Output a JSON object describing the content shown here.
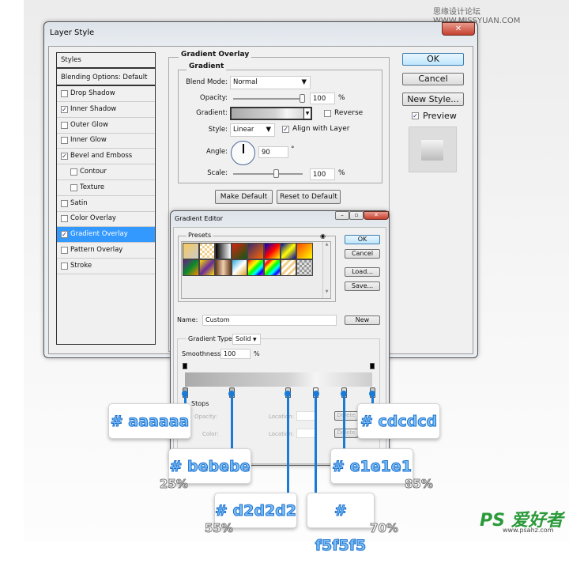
{
  "watermark": "思缘设计论坛  WWW.MISSYUAN.COM",
  "logo": {
    "text": "PS 爱好者",
    "url": "www.psahz.com"
  },
  "layer_style": {
    "title": "Layer Style",
    "styles_header": "Styles",
    "blending": "Blending Options: Default",
    "items": [
      {
        "label": "Drop Shadow",
        "checked": false
      },
      {
        "label": "Inner Shadow",
        "checked": true
      },
      {
        "label": "Outer Glow",
        "checked": false
      },
      {
        "label": "Inner Glow",
        "checked": false
      },
      {
        "label": "Bevel and Emboss",
        "checked": true
      },
      {
        "label": "Contour",
        "checked": false
      },
      {
        "label": "Texture",
        "checked": false
      },
      {
        "label": "Satin",
        "checked": false
      },
      {
        "label": "Color Overlay",
        "checked": false
      },
      {
        "label": "Gradient Overlay",
        "checked": true,
        "selected": true
      },
      {
        "label": "Pattern Overlay",
        "checked": false
      },
      {
        "label": "Stroke",
        "checked": false
      }
    ],
    "section": "Gradient Overlay",
    "subsection": "Gradient",
    "blend_mode_label": "Blend Mode:",
    "blend_mode": "Normal",
    "opacity_label": "Opacity:",
    "opacity": "100",
    "pct": "%",
    "gradient_label": "Gradient:",
    "reverse": "Reverse",
    "style_label": "Style:",
    "style": "Linear",
    "align": "Align with Layer",
    "angle_label": "Angle:",
    "angle": "90",
    "deg": "°",
    "scale_label": "Scale:",
    "scale": "100",
    "make_default": "Make Default",
    "reset_default": "Reset to Default",
    "ok": "OK",
    "cancel": "Cancel",
    "new_style": "New Style...",
    "preview": "Preview"
  },
  "gradient_editor": {
    "title": "Gradient Editor",
    "presets": "Presets",
    "ok": "OK",
    "cancel": "Cancel",
    "load": "Load...",
    "save": "Save...",
    "name_label": "Name:",
    "name": "Custom",
    "new": "New",
    "type_label": "Gradient Type:",
    "type": "Solid",
    "smooth_label": "Smoothness:",
    "smooth": "100",
    "pct": "%",
    "stops": "Stops",
    "opacity_label": "Opacity:",
    "color_label": "Color:",
    "location_label": "Location:",
    "delete": "Delete"
  },
  "color_stops": [
    {
      "color": "#aaaaaa",
      "label": "# aaaaaa",
      "location": 0
    },
    {
      "color": "#bebebe",
      "label": "# bebebe",
      "location": 25,
      "pct": "25%"
    },
    {
      "color": "#d2d2d2",
      "label": "# d2d2d2",
      "location": 55,
      "pct": "55%"
    },
    {
      "color": "#f5f5f5",
      "label": "# f5f5f5",
      "location": 70,
      "pct": "70%"
    },
    {
      "color": "#e1e1e1",
      "label": "# e1e1e1",
      "location": 85,
      "pct": "85%"
    },
    {
      "color": "#cdcdcd",
      "label": "# cdcdcd",
      "location": 100
    }
  ],
  "accent": "#1a7bd6"
}
